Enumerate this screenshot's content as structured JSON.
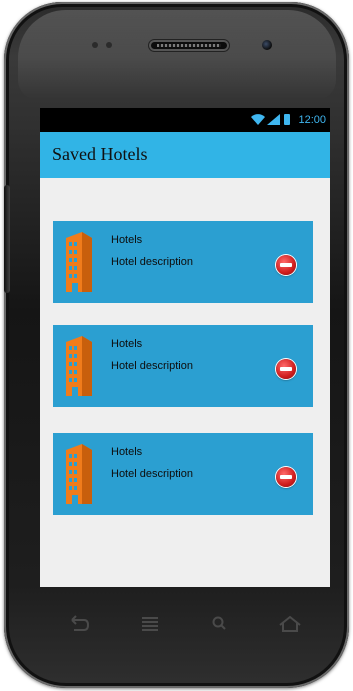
{
  "status_bar": {
    "time": "12:00"
  },
  "app_bar": {
    "title": "Saved Hotels"
  },
  "hotels": [
    {
      "title": "Hotels",
      "description": "Hotel description"
    },
    {
      "title": "Hotels",
      "description": "Hotel description"
    },
    {
      "title": "Hotels",
      "description": "Hotel description"
    }
  ],
  "colors": {
    "app_bar": "#31b4e6",
    "card": "#2b9fd1",
    "hotel_icon": "#f07c1b",
    "remove": "#cf1d1d",
    "status_accent": "#3fb6f0"
  },
  "icons": {
    "hotel": "hotel-building-icon",
    "remove": "remove-circle-icon",
    "back": "back-icon",
    "home": "home-icon",
    "menu": "menu-icon",
    "search": "search-icon"
  }
}
